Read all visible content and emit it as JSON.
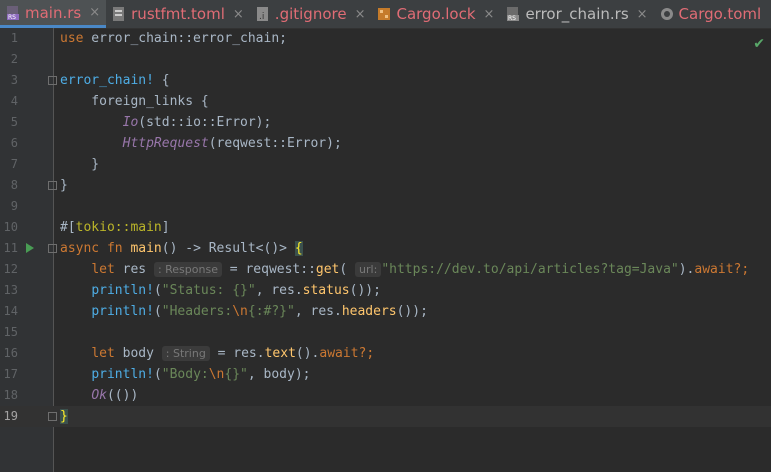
{
  "tabs": [
    {
      "label": "main.rs",
      "icon": "rust-file-icon",
      "active": true
    },
    {
      "label": "rustfmt.toml",
      "icon": "toml-file-icon",
      "active": false
    },
    {
      "label": ".gitignore",
      "icon": "ignore-file-icon",
      "active": false
    },
    {
      "label": "Cargo.lock",
      "icon": "cargo-file-icon",
      "active": false
    },
    {
      "label": "error_chain.rs",
      "icon": "rust-file-icon",
      "active": false
    },
    {
      "label": "Cargo.toml",
      "icon": "toml-file-icon",
      "active": false
    }
  ],
  "close_glyph": "×",
  "status_check": "✔",
  "line_numbers": [
    "1",
    "2",
    "3",
    "4",
    "5",
    "6",
    "7",
    "8",
    "9",
    "10",
    "11",
    "12",
    "13",
    "14",
    "15",
    "16",
    "17",
    "18",
    "19"
  ],
  "code": {
    "l1": {
      "kw": "use",
      "rest": " error_chain::error_chain;"
    },
    "l3": {
      "mac": "error_chain!",
      "rest": " {"
    },
    "l4": {
      "text": "    foreign_links {"
    },
    "l5": {
      "indent": "        ",
      "var": "Io",
      "rest": "(std::io::Error);"
    },
    "l6": {
      "indent": "        ",
      "var": "HttpRequest",
      "rest": "(reqwest::Error);"
    },
    "l7": {
      "text": "    }"
    },
    "l8": {
      "text": "}"
    },
    "l10": {
      "pre": "#[",
      "attr": "tokio::main",
      "post": "]"
    },
    "l11": {
      "kw1": "async",
      "kw2": "fn",
      "fn": "main",
      "rest": "() -> Result<()> ",
      "brace": "{"
    },
    "l12": {
      "kw": "let",
      "name": "res",
      "hint": ": Response",
      "eq": " = reqwest::",
      "fn": "get",
      "open": "(",
      "hint2": "url:",
      "str": "\"https://dev.to/api/articles?tag=Java\"",
      "close": ").",
      "aw": "await",
      "end": "?;"
    },
    "l13": {
      "mac": "println!",
      "open": "(",
      "str": "\"Status: {}\"",
      "mid": ", res.",
      "fn": "status",
      "end": "());"
    },
    "l14": {
      "mac": "println!",
      "open": "(",
      "str1": "\"Headers:",
      "esc": "\\n",
      "str2": "{:#?}\"",
      "mid": ", res.",
      "fn": "headers",
      "end": "());"
    },
    "l16": {
      "kw": "let",
      "name": "body",
      "hint": ": String",
      "eq": " = res.",
      "fn": "text",
      "mid": "().",
      "aw": "await",
      "end": "?;"
    },
    "l17": {
      "mac": "println!",
      "open": "(",
      "str1": "\"Body:",
      "esc": "\\n",
      "str2": "{}\"",
      "end": ", body);"
    },
    "l18": {
      "var": "Ok",
      "rest": "(())"
    },
    "l19": {
      "brace": "}"
    }
  }
}
